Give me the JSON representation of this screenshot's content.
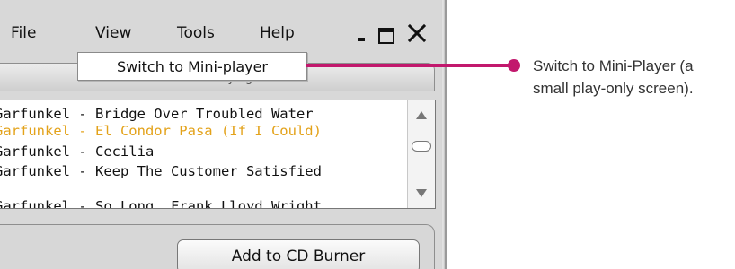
{
  "menubar": {
    "items": [
      "File",
      "View",
      "Tools",
      "Help"
    ]
  },
  "window_controls": {
    "minimize": "minimize-icon",
    "maximize": "maximize-icon",
    "close": "close-icon"
  },
  "popup": {
    "item_label": "Switch to Mini-player"
  },
  "now_playing": {
    "header_label": "Now Playing"
  },
  "playlist": {
    "tracks": [
      {
        "title": "Garfunkel - Bridge Over Troubled Water"
      },
      {
        "title": "Garfunkel - El Condor Pasa (If I Could)"
      },
      {
        "title": "Garfunkel - Cecilia"
      },
      {
        "title": "Garfunkel - Keep The Customer Satisfied"
      },
      {
        "title": "Garfunkel - So Long, Frank Lloyd Wright"
      }
    ],
    "active_color": "#e3a21a"
  },
  "buttons": {
    "add_to_cd_burner": "Add to CD Burner"
  },
  "callout": {
    "line1": "Switch to Mini-Player (a",
    "line2": "small play-only screen).",
    "color": "#c2186d"
  }
}
